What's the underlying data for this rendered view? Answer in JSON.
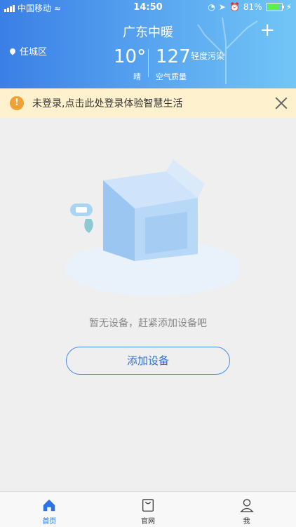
{
  "status_bar": {
    "carrier": "中国移动",
    "time": "14:50",
    "battery": "81%"
  },
  "header": {
    "title": "广东中暖",
    "location": "任城区",
    "temperature": "10°",
    "condition": "晴",
    "aqi_value": "127",
    "aqi_level": "轻度污染",
    "aqi_label": "空气质量"
  },
  "notice": {
    "text": "未登录,点击此处登录体验智慧生活"
  },
  "empty_state": {
    "message": "暂无设备，赶紧添加设备吧",
    "add_button_label": "添加设备"
  },
  "tabs": [
    {
      "label": "首页",
      "active": true
    },
    {
      "label": "官网",
      "active": false
    },
    {
      "label": "我",
      "active": false
    }
  ],
  "colors": {
    "accent": "#2a74e8",
    "header_start": "#3a7fe6",
    "header_end": "#71c6f7",
    "notice_bg": "#fdf1ce",
    "warn": "#f1a033"
  }
}
